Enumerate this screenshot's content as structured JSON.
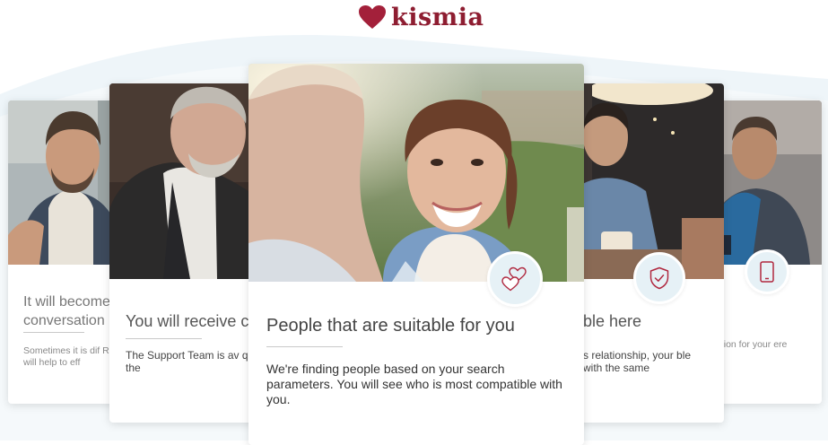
{
  "brand": {
    "name": "kismia",
    "color": "#8e1d31"
  },
  "colors": {
    "badge_bg": "#e6f1f6",
    "icon_stroke": "#b0283f",
    "wave": "#eaf3f8"
  },
  "cards": [
    {
      "title": "It will become",
      "title_line2": "conversation",
      "description": "Sometimes it is dif Ready-made ideas gifts will help to eff",
      "icon": null
    },
    {
      "title": "You will receive c",
      "description": "The Support Team is av question or suggest the",
      "icon": null
    },
    {
      "title": "People that are suitable for you",
      "description": "We're finding people based on your search parameters. You will see who is most compatible with you.",
      "icon": "two-hearts-icon"
    },
    {
      "title": "ble here",
      "description": "s relationship, your ble with the same",
      "icon": "shield-check-icon"
    },
    {
      "title": "",
      "description": "rsion for your ere",
      "icon": "mobile-phone-icon"
    }
  ]
}
